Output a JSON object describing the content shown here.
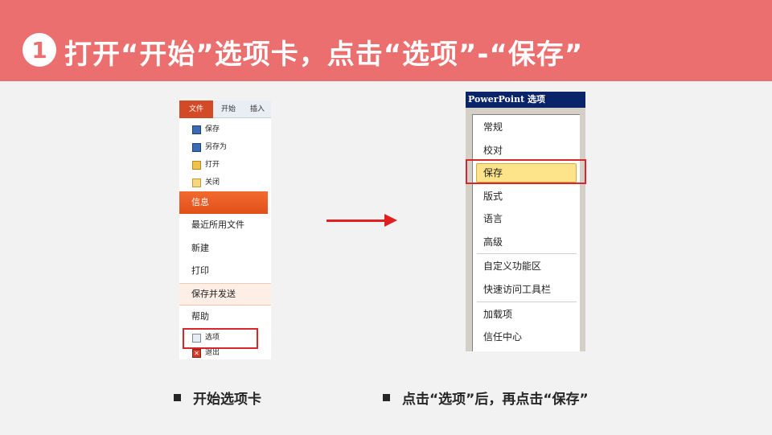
{
  "header": {
    "step_number": "1",
    "title": "打开“开始”选项卡，点击“选项”-“保存”",
    "banner_color": "#ea6f6e"
  },
  "left_screenshot": {
    "tabs": [
      "文件",
      "开始",
      "插入"
    ],
    "small_items": [
      {
        "label": "保存",
        "icon": "save-icon"
      },
      {
        "label": "另存为",
        "icon": "save-as-icon"
      },
      {
        "label": "打开",
        "icon": "open-folder-icon"
      },
      {
        "label": "关闭",
        "icon": "close-folder-icon"
      }
    ],
    "info_label": "信息",
    "big_items": [
      "最近所用文件",
      "新建",
      "打印",
      "保存并发送",
      "帮助"
    ],
    "options_label": "选项",
    "exit_label": "退出"
  },
  "right_screenshot": {
    "title": "PowerPoint 选项",
    "items": [
      "常规",
      "校对",
      "保存",
      "版式",
      "语言",
      "高级",
      "自定义功能区",
      "快速访问工具栏",
      "加载项",
      "信任中心"
    ],
    "selected_item": "保存"
  },
  "captions": {
    "left": "开始选项卡",
    "right": "点击“选项”后，再点击“保存”"
  },
  "colors": {
    "highlight_red": "#d8262b",
    "arrow_red": "#e02020",
    "accent_orange": "#e2501a"
  }
}
